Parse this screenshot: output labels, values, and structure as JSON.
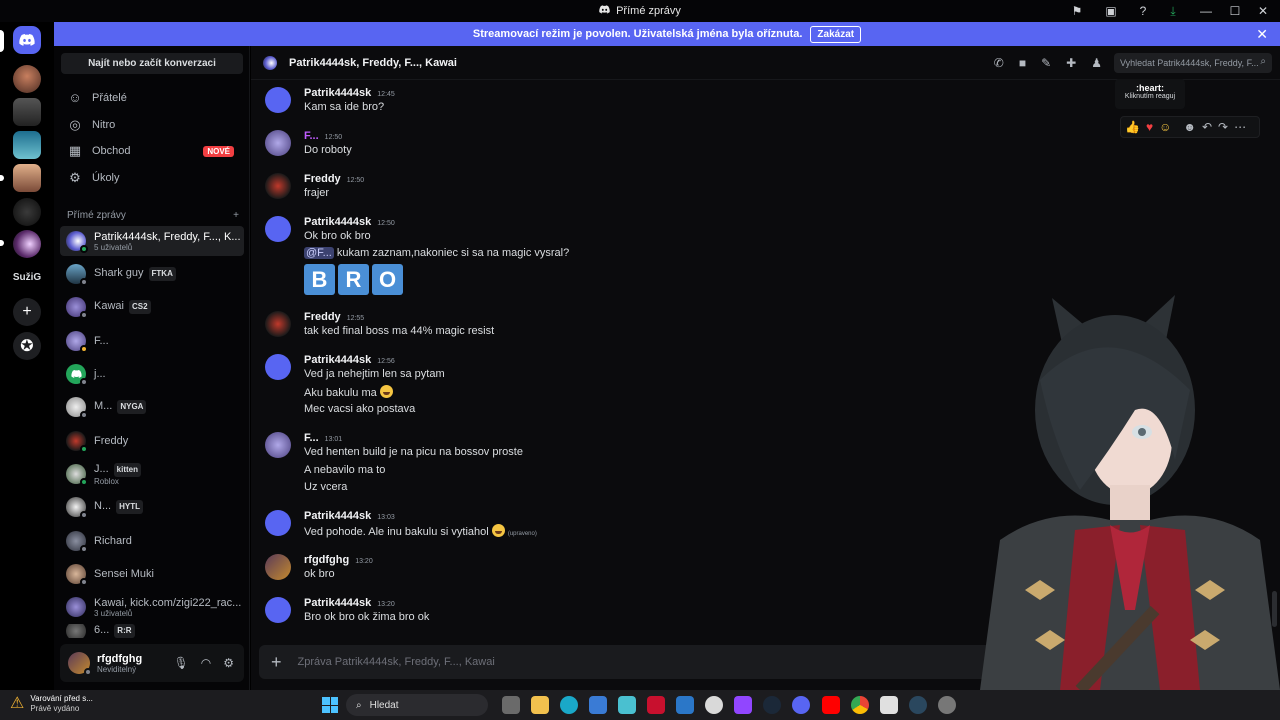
{
  "window": {
    "title": "Přímé zprávy",
    "controls": [
      "minimize-icon",
      "maximize-icon",
      "close-icon"
    ]
  },
  "banner": {
    "text": "Streamovací režim je povolen. Uživatelská jména byla oříznuta.",
    "button": "Zakázat"
  },
  "rail": {
    "label": "SužiG"
  },
  "sidebar": {
    "find": "Najít nebo začít konverzaci",
    "nav": [
      {
        "label": "Přátelé",
        "icon": "friends-icon"
      },
      {
        "label": "Nitro",
        "icon": "nitro-icon"
      },
      {
        "label": "Obchod",
        "icon": "shop-icon",
        "badge": "NOVÉ"
      },
      {
        "label": "Úkoly",
        "icon": "quests-icon"
      }
    ],
    "dm_header": "Přímé zprávy",
    "dm_add": "+",
    "dms": [
      {
        "name": "Patrik4444sk, Freddy, F..., K...",
        "sub": "5 uživatelů"
      },
      {
        "name": "Shark guy",
        "tag": "FTKA"
      },
      {
        "name": "Kawai",
        "tag": "CS2"
      },
      {
        "name": "F..."
      },
      {
        "name": "j..."
      },
      {
        "name": "M...",
        "tag": "NYGA"
      },
      {
        "name": "Freddy"
      },
      {
        "name": "J...",
        "tag": "kitten",
        "sub": "Roblox"
      },
      {
        "name": "N...",
        "tag": "HYTL"
      },
      {
        "name": "Richard"
      },
      {
        "name": "Sensei Muki"
      },
      {
        "name": "Kawai, kick.com/zigi222_rac...",
        "sub": "3 uživatelů"
      },
      {
        "name": "6...",
        "tag": "R:R"
      }
    ],
    "user": {
      "name": "rfgdfghg",
      "status": "Neviditelný"
    }
  },
  "chat": {
    "title": "Patrik4444sk, Freddy, F..., Kawai",
    "search_placeholder": "Vyhledat Patrik4444sk, Freddy, F...",
    "messages": [
      {
        "author": "Patrik4444sk",
        "time": "12:45",
        "lines": [
          "Kam sa ide bro?"
        ]
      },
      {
        "author": "F...",
        "time": "12:50",
        "lines": [
          "Do roboty"
        ]
      },
      {
        "author": "Freddy",
        "time": "12:50",
        "lines": [
          "frajer"
        ]
      },
      {
        "author": "Patrik4444sk",
        "time": "12:50",
        "lines": [
          "Ok bro ok bro"
        ],
        "mention": "@F...",
        "mention_text": " kukam zaznam,nakoniec si sa na magic vysral?",
        "bro": [
          "B",
          "R",
          "O"
        ]
      },
      {
        "author": "Freddy",
        "time": "12:55",
        "lines": [
          "tak ked final boss ma 44% magic resist"
        ]
      },
      {
        "author": "Patrik4444sk",
        "time": "12:56",
        "lines": [
          "Ved ja nehejtim len sa pytam",
          "Aku bakulu ma",
          "Mec vacsi ako postava"
        ]
      },
      {
        "author": "F...",
        "time": "13:01",
        "lines": [
          "Ved henten build je na picu na bossov proste",
          "A nebavilo ma to",
          "Uz vcera"
        ]
      },
      {
        "author": "Patrik4444sk",
        "time": "13:03",
        "lines": [
          "Ved pohode. Ale inu bakulu si vytiahol"
        ],
        "edited": "(upraveno)"
      },
      {
        "author": "rfgdfghg",
        "time": "13:20",
        "lines": [
          "ok bro"
        ]
      },
      {
        "author": "Patrik4444sk",
        "time": "13:20",
        "lines": [
          "Bro ok bro ok žima bro ok"
        ]
      }
    ],
    "tooltip": {
      "title": ":heart:",
      "sub": "Kliknutím reaguj"
    },
    "composer_placeholder": "Zpráva Patrik4444sk, Freddy, F..., Kawai"
  },
  "taskbar": {
    "warning_title": "Varování před s...",
    "warning_sub": "Právě vydáno",
    "search": "Hledat"
  }
}
